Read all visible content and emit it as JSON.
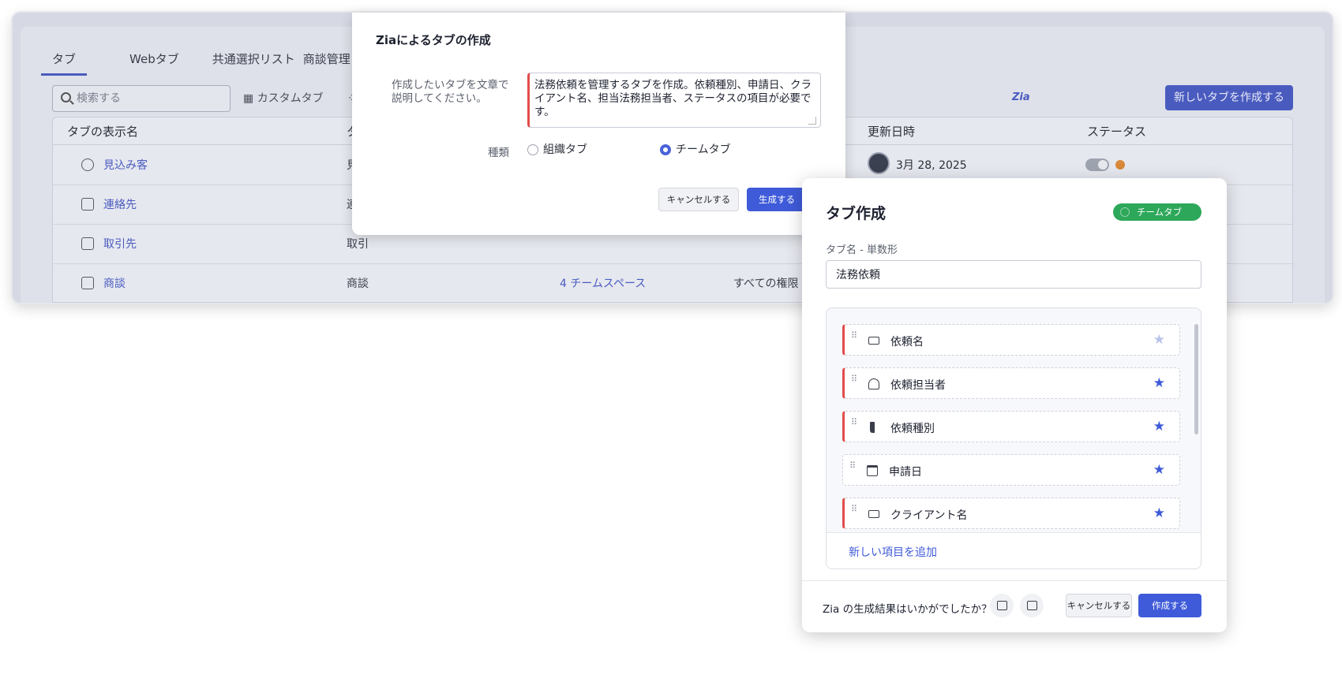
{
  "bg": {
    "tabs": [
      "タブ",
      "Webタブ",
      "共通選択リスト",
      "商談管理"
    ],
    "search_placeholder": "検索する",
    "custom_tab": "カスタムタブ",
    "team_tab_partial": "チー",
    "zia_label": "Zia",
    "new_tab_button": "新しいタブを作成する",
    "columns": [
      "タブの表示名",
      "タブ",
      "更新日時",
      "ステータス"
    ],
    "rows": [
      {
        "name": "見込み客",
        "type": "見込",
        "date": "3月 28, 2025",
        "team": "",
        "perm": ""
      },
      {
        "name": "連絡先",
        "type": "連絡",
        "date": "",
        "team": "",
        "perm": ""
      },
      {
        "name": "取引先",
        "type": "取引",
        "date": "",
        "team": "",
        "perm": ""
      },
      {
        "name": "商談",
        "type": "商談",
        "date": "",
        "team": "4 チームスペース",
        "perm": "すべての権限"
      }
    ]
  },
  "zia_modal": {
    "title": "Ziaによるタブの作成",
    "prompt_label": "作成したいタブを文章で説明してください。",
    "prompt_value": "法務依頼を管理するタブを作成。依頼種別、申請日、クライアント名、担当法務担当者、ステータスの項目が必要です。",
    "kind_label": "種類",
    "option_org": "組織タブ",
    "option_team": "チームタブ",
    "cancel": "キャンセルする",
    "generate": "生成する"
  },
  "panel": {
    "title": "タブ作成",
    "badge": "チームタブ",
    "name_label": "タブ名 - 単数形",
    "name_value": "法務依頼",
    "fields": [
      "依頼名",
      "依頼担当者",
      "依頼種別",
      "申請日",
      "クライアント名"
    ],
    "add_field": "新しい項目を追加",
    "feedback": "Zia の生成結果はいかがでしたか？",
    "cancel": "キャンセルする",
    "create": "作成する"
  },
  "colors": {
    "accent": "#3f5bd9",
    "required": "#e24c4c",
    "team_badge": "#2da85a"
  }
}
